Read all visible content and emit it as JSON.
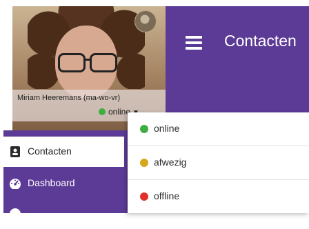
{
  "header": {
    "title": "Contacten"
  },
  "profile": {
    "name": "Miriam Heeremans (ma-wo-vr)",
    "status": {
      "label": "online",
      "color": "#3dae3f"
    }
  },
  "sidebar": {
    "items": [
      {
        "label": "Contacten",
        "icon": "contacts-card-icon",
        "active": true
      },
      {
        "label": "Dashboard",
        "icon": "dashboard-gauge-icon",
        "active": false
      }
    ]
  },
  "status_menu": {
    "options": [
      {
        "label": "online",
        "color": "#3dae3f"
      },
      {
        "label": "afwezig",
        "color": "#d6a61c"
      },
      {
        "label": "offline",
        "color": "#e0322b"
      }
    ]
  },
  "colors": {
    "brand_purple": "#5c3b96"
  }
}
